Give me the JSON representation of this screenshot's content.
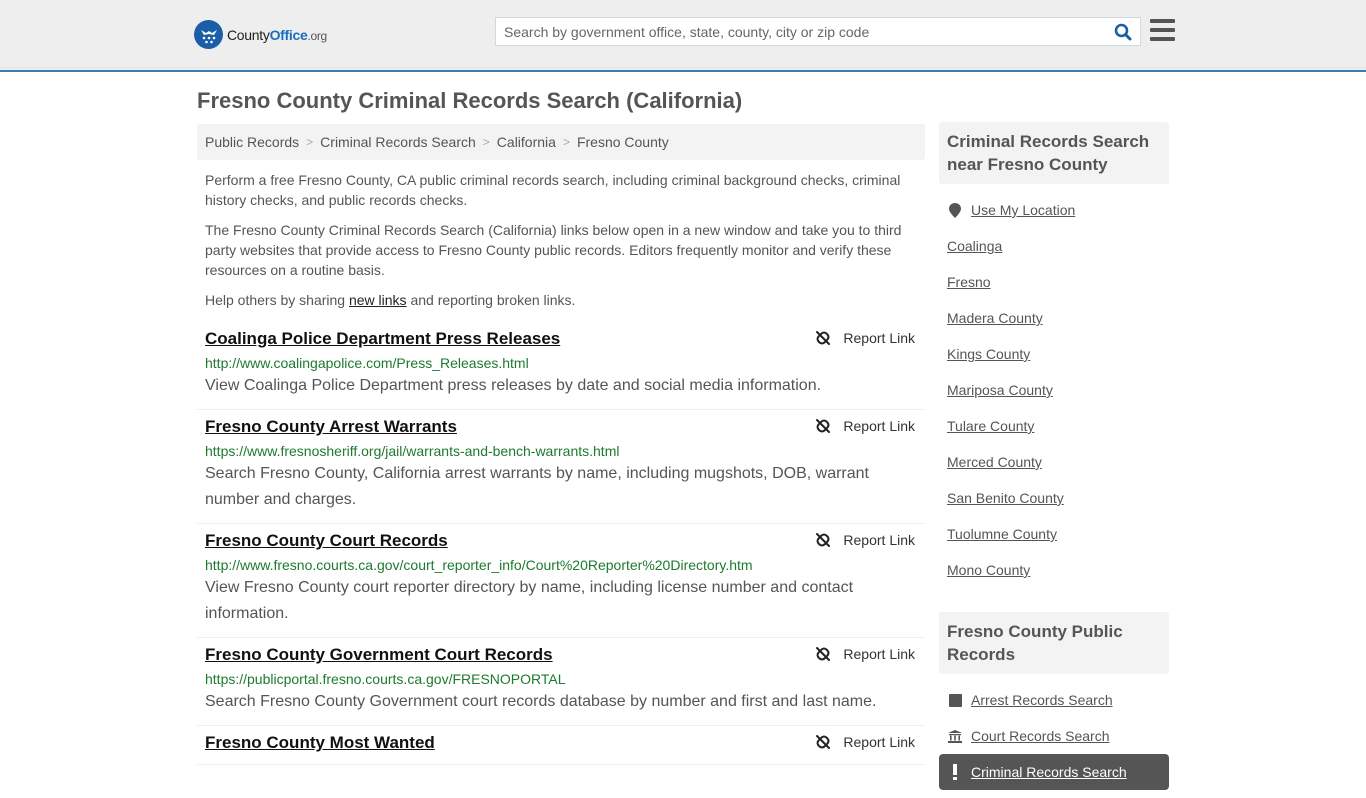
{
  "header": {
    "logo": {
      "name_part1": "County",
      "name_part2": "Office",
      "name_part3": ".org"
    },
    "search": {
      "placeholder": "Search by government office, state, county, city or zip code",
      "value": ""
    },
    "colors": {
      "brand": "#1b5ea8",
      "header_border": "#3b7bae"
    }
  },
  "page": {
    "title": "Fresno County Criminal Records Search (California)",
    "breadcrumb": [
      "Public Records",
      "Criminal Records Search",
      "California",
      "Fresno County"
    ],
    "intro": {
      "p1": "Perform a free Fresno County, CA public criminal records search, including criminal background checks, criminal history checks, and public records checks.",
      "p2": "The Fresno County Criminal Records Search (California) links below open in a new window and take you to third party websites that provide access to Fresno County public records. Editors frequently monitor and verify these resources on a routine basis.",
      "p3_before": "Help others by sharing ",
      "p3_link": "new links",
      "p3_after": " and reporting broken links."
    },
    "report_label": "Report Link",
    "results": [
      {
        "title": "Coalinga Police Department Press Releases",
        "url": "http://www.coalingapolice.com/Press_Releases.html",
        "desc": "View Coalinga Police Department press releases by date and social media information."
      },
      {
        "title": "Fresno County Arrest Warrants",
        "url": "https://www.fresnosheriff.org/jail/warrants-and-bench-warrants.html",
        "desc": "Search Fresno County, California arrest warrants by name, including mugshots, DOB, warrant number and charges."
      },
      {
        "title": "Fresno County Court Records",
        "url": "http://www.fresno.courts.ca.gov/court_reporter_info/Court%20Reporter%20Directory.htm",
        "desc": "View Fresno County court reporter directory by name, including license number and contact information."
      },
      {
        "title": "Fresno County Government Court Records",
        "url": "https://publicportal.fresno.courts.ca.gov/FRESNOPORTAL",
        "desc": "Search Fresno County Government court records database by number and first and last name."
      },
      {
        "title": "Fresno County Most Wanted",
        "url": "",
        "desc": ""
      }
    ]
  },
  "sidebar": {
    "nearby": {
      "heading": "Criminal Records Search near Fresno County",
      "use_location": "Use My Location",
      "items": [
        "Coalinga",
        "Fresno",
        "Madera County",
        "Kings County",
        "Mariposa County",
        "Tulare County",
        "Merced County",
        "San Benito County",
        "Tuolumne County",
        "Mono County"
      ]
    },
    "public_records": {
      "heading": "Fresno County Public Records",
      "items": [
        {
          "label": "Arrest Records Search",
          "icon": "square-icon"
        },
        {
          "label": "Court Records Search",
          "icon": "courthouse-icon"
        },
        {
          "label": "Criminal Records Search",
          "icon": "exclamation-icon",
          "active": true
        }
      ]
    }
  }
}
